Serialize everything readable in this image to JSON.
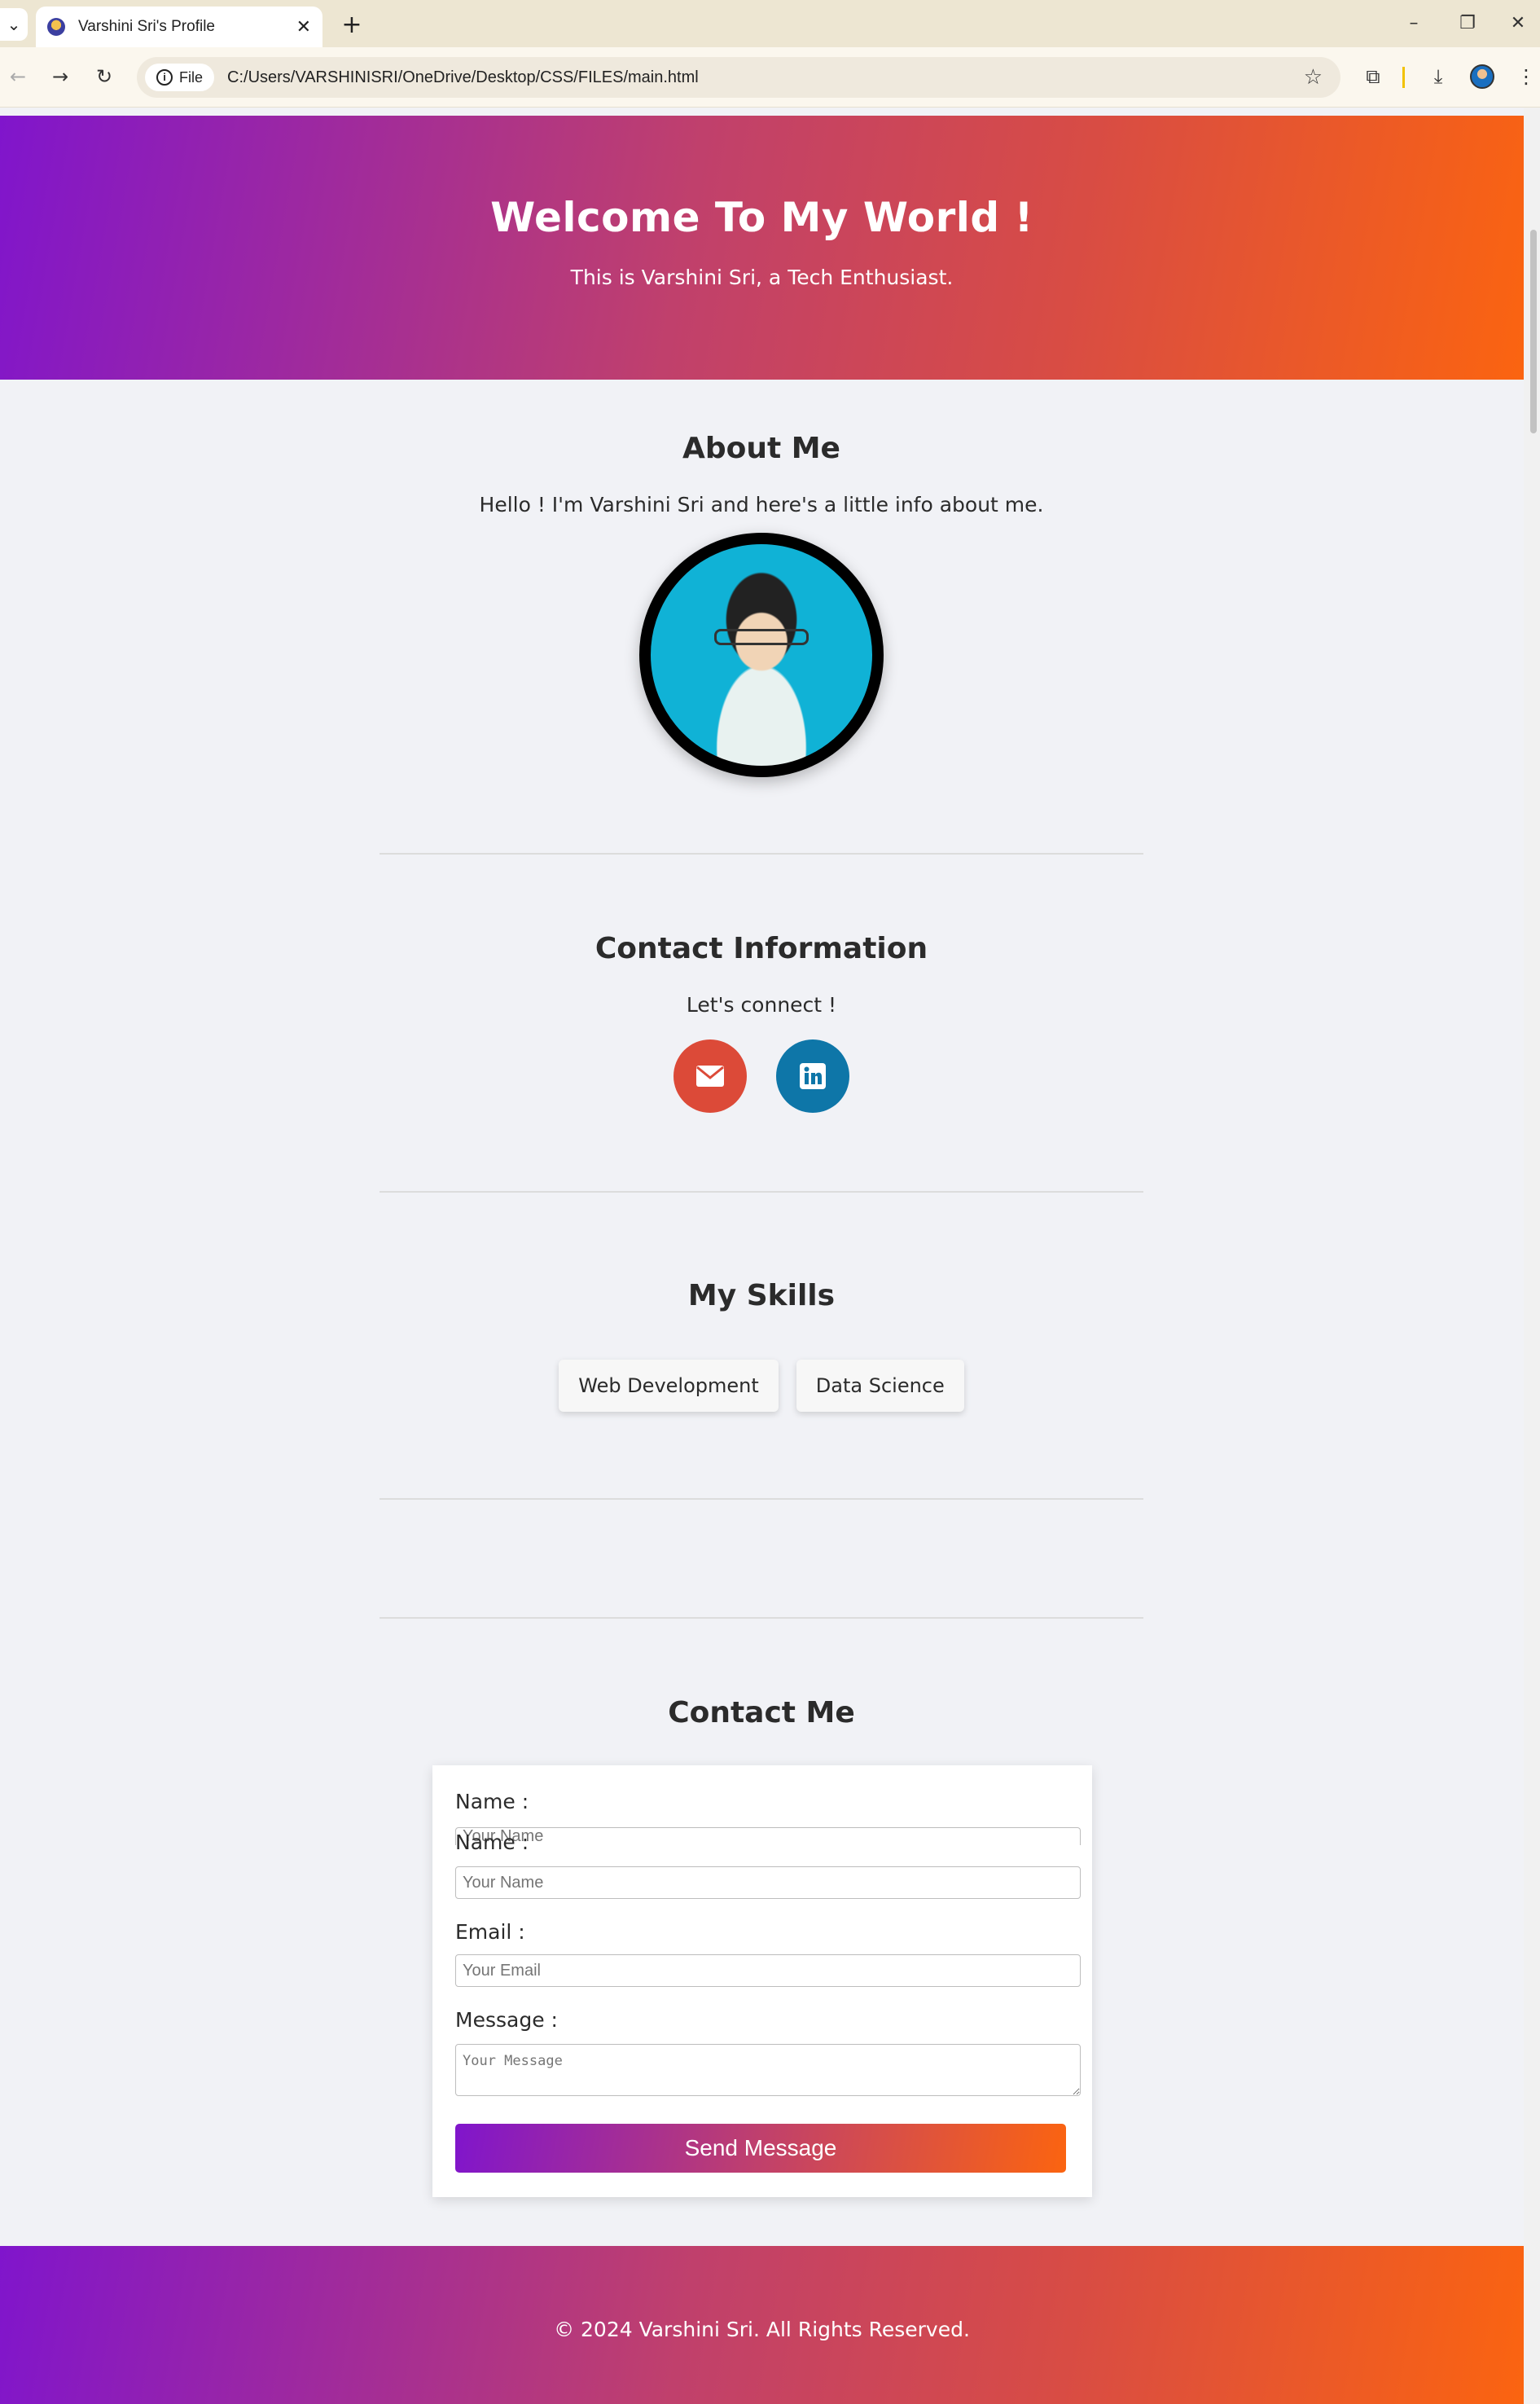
{
  "browser": {
    "tab_title": "Varshini Sri's Profile",
    "new_tab": "+",
    "site_chip": "File",
    "url": "C:/Users/VARSHINISRI/OneDrive/Desktop/CSS/FILES/main.html"
  },
  "hero": {
    "title": "Welcome To My World !",
    "subtitle": "This is Varshini Sri, a Tech Enthusiast."
  },
  "about": {
    "heading": "About Me",
    "text": "Hello ! I'm Varshini Sri and here's a little info about me."
  },
  "contact_info": {
    "heading": "Contact Information",
    "text": "Let's connect !",
    "links": [
      {
        "name": "email-icon",
        "color": "#dc4a38"
      },
      {
        "name": "linkedin-icon",
        "color": "#0e76a8"
      }
    ]
  },
  "skills": {
    "heading": "My Skills",
    "items": [
      "Web Development",
      "Data Science"
    ]
  },
  "contact_form": {
    "heading": "Contact Me",
    "name_label": "Name :",
    "name_label_dup": "Name :",
    "name_placeholder": "Your Name",
    "email_label": "Email :",
    "email_placeholder": "Your Email",
    "message_label": "Message :",
    "message_placeholder": "Your Message",
    "send_label": "Send Message"
  },
  "footer": {
    "text": "© 2024 Varshini Sri. All Rights Reserved."
  },
  "colors": {
    "gradient_start": "#8015cc",
    "gradient_end": "#fb6410",
    "page_bg": "#f1f2f6"
  }
}
